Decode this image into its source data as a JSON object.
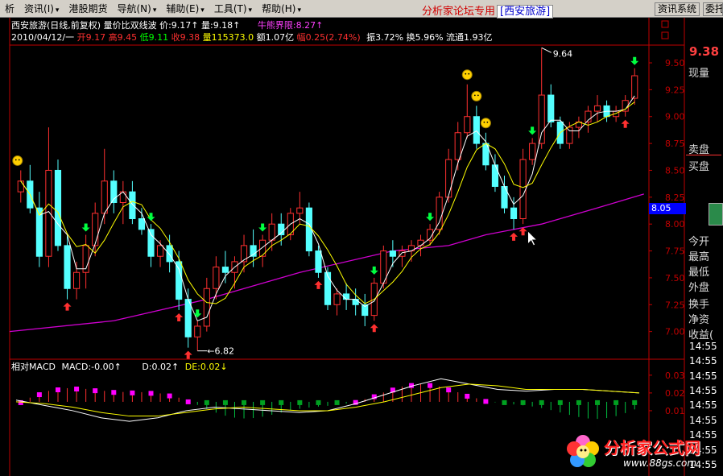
{
  "menu": {
    "items": [
      {
        "label": "析",
        "arrow": ""
      },
      {
        "label": "资讯(I)",
        "arrow": "▾"
      },
      {
        "label": "港股期货",
        "arrow": ""
      },
      {
        "label": "导航(N)",
        "arrow": "▾"
      },
      {
        "label": "辅助(E)",
        "arrow": "▾"
      },
      {
        "label": "工具(T)",
        "arrow": "▾"
      },
      {
        "label": "帮助(H)",
        "arrow": "▾"
      }
    ],
    "center_title": "分析家论坛专用",
    "center_stock": "[西安旅游]",
    "info_button": "资讯系统",
    "more_button": "委托"
  },
  "header": {
    "title": "西安旅游(日线,前复权) 量价比双线波 价:9.17↑ 量:9.18↑",
    "bull_limit": "牛熊界限:8.27↑",
    "date": "2010/04/12/一",
    "open": "开9.17",
    "high": "高9.45",
    "low": "低9.11",
    "close": "收9.38",
    "volume": "量115373.0",
    "amount": "额1.07亿",
    "change": "幅0.25(2.74%)",
    "amplitude": "振3.72%",
    "turnover": "换5.96%",
    "float": "流通1.93亿"
  },
  "right_panel": {
    "last_price": "9.38",
    "labels": [
      "现量",
      "卖盘",
      "买盘",
      "今开",
      "最高",
      "最低",
      "外盘",
      "换手",
      "净资",
      "收益("
    ],
    "level_tag": "8.05",
    "times": [
      "14:55",
      "14:55",
      "14:55",
      "14:55",
      "14:55",
      "14:55",
      "14:55",
      "14:55",
      "14:55"
    ]
  },
  "price_axis": {
    "labels": [
      "9.50",
      "9.25",
      "9.00",
      "8.75",
      "8.50",
      "8.25",
      "8.00",
      "7.75",
      "7.50",
      "7.25",
      "7.00"
    ]
  },
  "macd_header": {
    "name": "相对MACD",
    "macd": "MACD:-0.00↑",
    "d": "D:0.02↑",
    "de": "DE:0.02↓"
  },
  "macd_axis": {
    "labels": [
      "0.03",
      "0.02",
      "0.01"
    ]
  },
  "annotations": {
    "high_mark": "9.64",
    "low_mark": "6.82"
  },
  "watermark": {
    "title": "分析家公式网",
    "url": "www.88gs.com"
  },
  "colors": {
    "up": "#ff3030",
    "down": "#54ffff",
    "ma_short": "#ffffff",
    "ma_long": "#ffff00",
    "ma_purple": "#d000d0",
    "axis": "#c00000"
  },
  "chart_data": {
    "type": "candlestick",
    "ylim": [
      6.75,
      9.65
    ],
    "y_ticks": [
      7.0,
      7.25,
      7.5,
      7.75,
      8.0,
      8.25,
      8.5,
      8.75,
      9.0,
      9.25,
      9.5
    ],
    "candles": [
      [
        8.3,
        8.5,
        8.2,
        8.4
      ],
      [
        8.4,
        8.55,
        8.1,
        8.15
      ],
      [
        8.15,
        8.3,
        7.6,
        7.7
      ],
      [
        7.7,
        8.9,
        7.6,
        8.5
      ],
      [
        8.5,
        8.6,
        7.75,
        7.8
      ],
      [
        7.8,
        7.9,
        7.3,
        7.4
      ],
      [
        7.4,
        7.65,
        7.3,
        7.55
      ],
      [
        7.55,
        7.9,
        7.4,
        7.8
      ],
      [
        7.8,
        8.2,
        7.7,
        8.1
      ],
      [
        8.1,
        8.7,
        8.0,
        8.4
      ],
      [
        8.4,
        8.5,
        8.1,
        8.2
      ],
      [
        8.2,
        8.4,
        8.0,
        8.3
      ],
      [
        8.3,
        8.4,
        8.0,
        8.05
      ],
      [
        8.05,
        8.15,
        7.9,
        7.95
      ],
      [
        7.95,
        8.0,
        7.6,
        7.7
      ],
      [
        7.7,
        7.85,
        7.6,
        7.8
      ],
      [
        7.8,
        7.9,
        7.55,
        7.65
      ],
      [
        7.65,
        7.75,
        7.2,
        7.3
      ],
      [
        7.3,
        7.4,
        6.85,
        6.95
      ],
      [
        6.95,
        7.1,
        6.82,
        7.05
      ],
      [
        7.05,
        7.5,
        7.0,
        7.4
      ],
      [
        7.4,
        7.7,
        7.3,
        7.6
      ],
      [
        7.6,
        7.75,
        7.45,
        7.55
      ],
      [
        7.55,
        7.7,
        7.4,
        7.65
      ],
      [
        7.65,
        7.9,
        7.55,
        7.8
      ],
      [
        7.8,
        7.95,
        7.6,
        7.7
      ],
      [
        7.7,
        7.9,
        7.6,
        7.85
      ],
      [
        7.85,
        8.1,
        7.75,
        8.0
      ],
      [
        8.0,
        8.1,
        7.8,
        7.9
      ],
      [
        7.9,
        8.15,
        7.85,
        8.1
      ],
      [
        8.1,
        8.3,
        8.0,
        8.15
      ],
      [
        8.15,
        8.2,
        7.7,
        7.75
      ],
      [
        7.75,
        7.8,
        7.5,
        7.55
      ],
      [
        7.55,
        7.6,
        7.2,
        7.25
      ],
      [
        7.25,
        7.4,
        7.15,
        7.35
      ],
      [
        7.35,
        7.45,
        7.2,
        7.3
      ],
      [
        7.3,
        7.4,
        7.15,
        7.25
      ],
      [
        7.25,
        7.35,
        7.05,
        7.15
      ],
      [
        7.15,
        7.5,
        7.1,
        7.45
      ],
      [
        7.45,
        7.8,
        7.4,
        7.75
      ],
      [
        7.75,
        7.85,
        7.6,
        7.7
      ],
      [
        7.7,
        7.8,
        7.6,
        7.75
      ],
      [
        7.75,
        7.85,
        7.65,
        7.8
      ],
      [
        7.8,
        7.9,
        7.7,
        7.85
      ],
      [
        7.85,
        8.0,
        7.8,
        7.95
      ],
      [
        7.95,
        8.3,
        7.9,
        8.25
      ],
      [
        8.25,
        8.7,
        8.2,
        8.6
      ],
      [
        8.6,
        8.95,
        8.5,
        8.85
      ],
      [
        8.85,
        9.3,
        8.8,
        9.0
      ],
      [
        9.0,
        9.1,
        8.7,
        8.75
      ],
      [
        8.75,
        8.85,
        8.5,
        8.55
      ],
      [
        8.55,
        8.65,
        8.3,
        8.35
      ],
      [
        8.35,
        8.45,
        8.1,
        8.15
      ],
      [
        8.15,
        8.25,
        7.95,
        8.05
      ],
      [
        8.05,
        8.7,
        8.0,
        8.6
      ],
      [
        8.6,
        8.8,
        8.55,
        8.75
      ],
      [
        8.75,
        9.64,
        8.7,
        9.2
      ],
      [
        9.2,
        9.3,
        8.9,
        8.95
      ],
      [
        8.95,
        9.0,
        8.7,
        8.75
      ],
      [
        8.75,
        8.95,
        8.7,
        8.9
      ],
      [
        8.9,
        9.0,
        8.8,
        8.95
      ],
      [
        8.95,
        9.1,
        8.85,
        9.05
      ],
      [
        9.05,
        9.2,
        8.95,
        9.1
      ],
      [
        9.1,
        9.15,
        8.95,
        9.0
      ],
      [
        9.0,
        9.1,
        8.95,
        9.05
      ],
      [
        9.05,
        9.2,
        9.0,
        9.15
      ],
      [
        9.17,
        9.45,
        9.11,
        9.38
      ]
    ],
    "ma_purple": [
      [
        0,
        7.0
      ],
      [
        10,
        7.1
      ],
      [
        20,
        7.3
      ],
      [
        30,
        7.55
      ],
      [
        40,
        7.75
      ],
      [
        46,
        7.8
      ],
      [
        50,
        7.9
      ],
      [
        56,
        8.0
      ],
      [
        62,
        8.15
      ],
      [
        67,
        8.28
      ]
    ],
    "macd_lines": {
      "d": [
        0.016,
        0.013,
        0.01,
        0.006,
        0.004,
        0.006,
        0.01,
        0.012,
        0.011,
        0.01,
        0.009,
        0.01,
        0.014,
        0.019,
        0.024,
        0.028,
        0.025,
        0.022,
        0.021,
        0.022,
        0.022,
        0.021,
        0.02
      ],
      "de": [
        0.015,
        0.014,
        0.012,
        0.009,
        0.007,
        0.007,
        0.009,
        0.011,
        0.012,
        0.011,
        0.01,
        0.01,
        0.012,
        0.015,
        0.019,
        0.023,
        0.025,
        0.024,
        0.022,
        0.022,
        0.022,
        0.021,
        0.02
      ]
    }
  }
}
